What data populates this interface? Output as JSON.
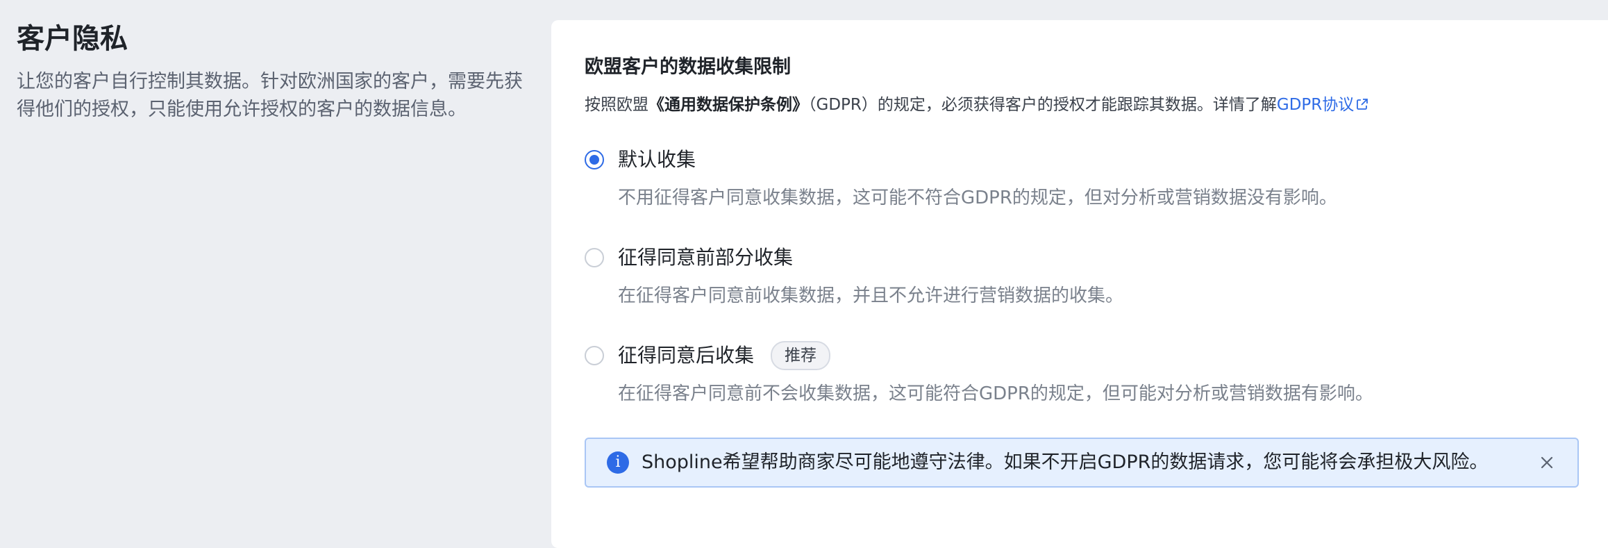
{
  "left": {
    "title": "客户隐私",
    "description": "让您的客户自行控制其数据。针对欧洲国家的客户，需要先获得他们的授权，只能使用允许授权的客户的数据信息。"
  },
  "card": {
    "title": "欧盟客户的数据收集限制",
    "desc_prefix": "按照欧盟",
    "desc_bold": "《通用数据保护条例》",
    "desc_middle": "（GDPR）的规定，必须获得客户的授权才能跟踪其数据。详情了解",
    "desc_link": "GDPR协议",
    "options": [
      {
        "label": "默认收集",
        "description": "不用征得客户同意收集数据，这可能不符合GDPR的规定，但对分析或营销数据没有影响。",
        "checked": true
      },
      {
        "label": "征得同意前部分收集",
        "description": "在征得客户同意前收集数据，并且不允许进行营销数据的收集。",
        "checked": false
      },
      {
        "label": "征得同意后收集",
        "badge": "推荐",
        "description": "在征得客户同意前不会收集数据，这可能符合GDPR的规定，但可能对分析或营销数据有影响。",
        "checked": false
      }
    ],
    "alert": {
      "icon": "info-icon",
      "text": "Shopline希望帮助商家尽可能地遵守法律。如果不开启GDPR的数据请求，您可能将会承担极大风险。"
    }
  },
  "colors": {
    "background": "#eceef2",
    "card": "#ffffff",
    "accent": "#2e6be6",
    "alert_bg": "#e6f0fe",
    "alert_border": "#a9c6f5"
  }
}
